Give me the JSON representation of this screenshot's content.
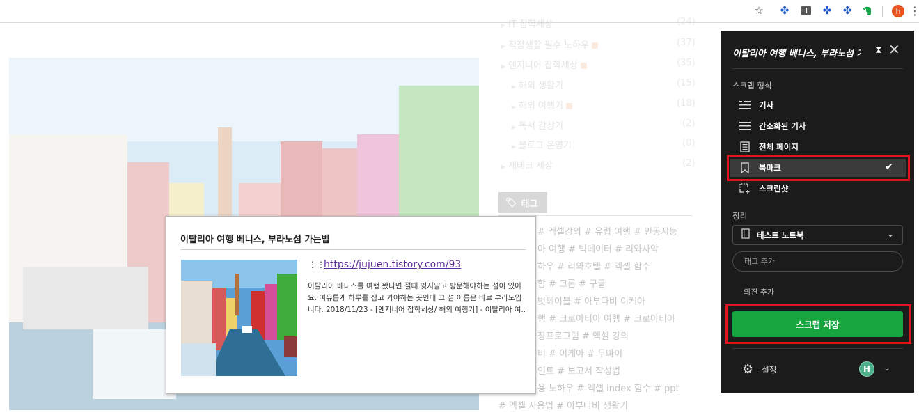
{
  "toolbar": {
    "icons": [
      "star-icon",
      "puzzle-extension-icon",
      "i-extension-icon",
      "puzzle-extension-icon",
      "puzzle-extension-icon",
      "evernote-icon",
      "profile-avatar",
      "menu-icon"
    ],
    "profile_letter": "h",
    "i_extension_letter": "I"
  },
  "blog": {
    "categories": [
      {
        "label": "IT 잡학세상",
        "count": "(24)"
      },
      {
        "label": "직장생활 필수 노하우",
        "count": "(37)"
      },
      {
        "label": "엔지니어 잡학세상",
        "count": "(35)"
      },
      {
        "label": "해외 생활기",
        "count": "(15)"
      },
      {
        "label": "해외 여행기",
        "count": "(18)"
      },
      {
        "label": "독서 감상기",
        "count": "(2)"
      },
      {
        "label": "블로그 운영기",
        "count": "(0)"
      },
      {
        "label": "재테크 세상",
        "count": "(2)"
      }
    ],
    "tag_button": "태그",
    "tag_rows": [
      "# 엑셀강의  # 유럽 여행  # 인공지능",
      "아 여행  # 빅데이터  # 리와사악",
      "하우  # 리와호텔  # 엑셀 함수",
      "함  # 크롬  # 구글",
      "벗테이블  # 아부다비 이케아",
      "행  # 크로아티아 여행  # 크로아티아",
      "장프로그램  # 엑셀 강의",
      "비  # 이케아  # 두바이",
      "인트  # 보고서 작성법",
      "용 노하우  # 엑셀 index 함수  # ppt",
      "# 엑셀 사용법  # 아부다비 생활기"
    ]
  },
  "card": {
    "title": "이탈리아 여행 베니스, 부라노섬 가는법",
    "url": "https://jujuen.tistory.com/93",
    "description": "이탈리아 베니스를 여행 왔다면 절때 잊지말고 방문해야하는 섬이 있어요. 여유롭게 하루를 잡고 가야하는 곳인데 그 섬 이름은 바로 부라노입니다. 2018/11/23 - [엔지니어 잡학세상/ 해외 여행기] - 이탈리아 여.."
  },
  "clipper": {
    "title": "이탈리아 여행 베니스, 부라노섬 가",
    "section_format": "스크랩 형식",
    "options": [
      {
        "label": "기사",
        "icon": "article-icon",
        "selected": false
      },
      {
        "label": "간소화된 기사",
        "icon": "simplified-article-icon",
        "selected": false
      },
      {
        "label": "전체 페이지",
        "icon": "full-page-icon",
        "selected": false
      },
      {
        "label": "북마크",
        "icon": "bookmark-icon",
        "selected": true
      },
      {
        "label": "스크린샷",
        "icon": "screenshot-icon",
        "selected": false
      }
    ],
    "section_organize": "정리",
    "notebook": "테스트 노트북",
    "tag_placeholder": "태그 추가",
    "comment_label": "의견 추가",
    "save_label": "스크랩 저장",
    "settings_label": "설정",
    "account_letter": "H",
    "highlight_color": "#e0141c",
    "save_color": "#16a53e"
  }
}
